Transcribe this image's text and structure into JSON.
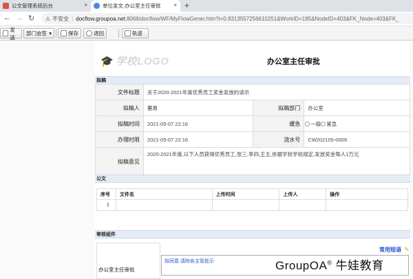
{
  "browser": {
    "tabs": [
      {
        "title": "公文管理系统后台"
      },
      {
        "title": "单位发文.办公室主任审批"
      }
    ],
    "nav": {
      "back": "←",
      "forward": "→",
      "reload": "↻",
      "newtab": "+",
      "close": "×"
    },
    "address": {
      "security": "不安全",
      "host": "docflow.groupoa.net",
      "path": ":8066/docflow/WF/MyFlowGener.htm?t=0.8313557256610251&WorkID=195&NodeID=403&FK_Node=403&FK_"
    }
  },
  "toolbar": {
    "send": "发送",
    "department": "部门会签",
    "save": "保存",
    "return": "退回",
    "track": "轨迹"
  },
  "logo": {
    "text": "学校LOGO"
  },
  "document": {
    "title": "办公室主任审批",
    "draft_section": "拟稿",
    "fields": {
      "title_label": "文件标题",
      "title_value": "关于2020-2021年度优秀员工奖金发放的请示",
      "drafter_label": "拟稿人",
      "drafter_value": "蕙易",
      "dept_label": "拟稿部门",
      "dept_value": "办公室",
      "draft_time_label": "拟稿时间",
      "draft_time_value": "2021-05-07 22:16",
      "urgency_label": "缓急",
      "urgency_options": [
        "一般",
        "紧急"
      ],
      "deadline_label": "办理时限",
      "deadline_value": "2021-05-07 22:16",
      "serial_label": "流水号",
      "serial_value": "CW202105-0009",
      "opinion_label": "拟稿意见",
      "opinion_value": "2020-2021年度,以下人员获得优秀员工,张三,李四,王五,依据学校学校规定,发放奖金每人1万元"
    },
    "official_section": "公文",
    "files_table": {
      "headers": [
        "序号",
        "文件名",
        "上传时间",
        "上传人",
        "操作"
      ],
      "rows": [
        [
          "1",
          "",
          "",
          "",
          ""
        ]
      ]
    },
    "review_section": "审核组件",
    "review": {
      "label": "办公室主任审批",
      "phrases": "常用短语",
      "opinion": "拟同意,请附俞主管批示"
    }
  },
  "watermark": {
    "brand": "GroupOA",
    "reg": "®",
    "tagline": " 牛娃教育"
  }
}
